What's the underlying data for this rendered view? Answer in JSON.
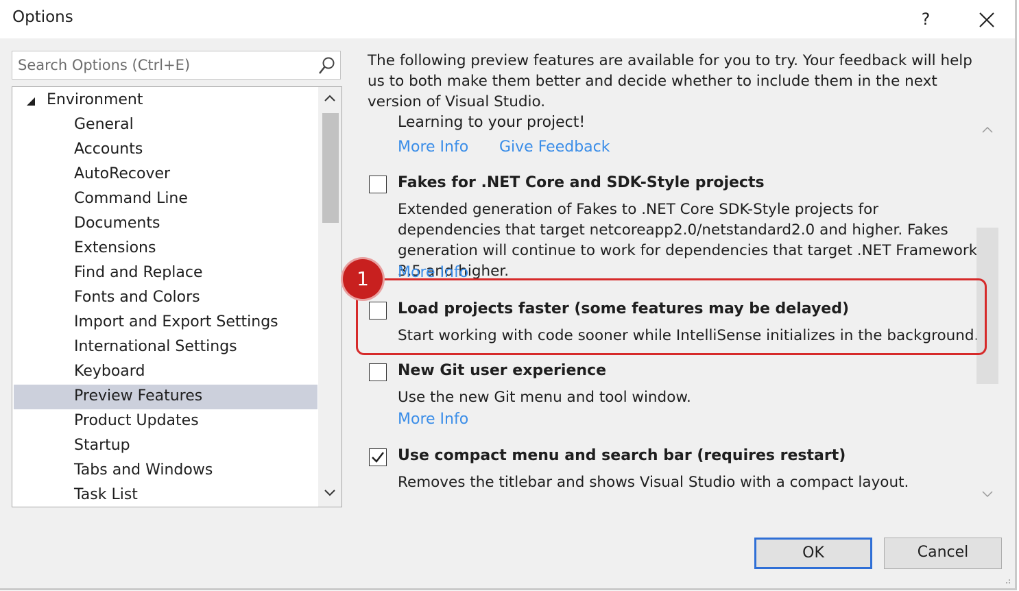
{
  "window": {
    "title": "Options",
    "help_label": "?"
  },
  "search": {
    "placeholder": "Search Options (Ctrl+E)",
    "value": ""
  },
  "tree": {
    "root": "Environment",
    "items": [
      {
        "label": "General"
      },
      {
        "label": "Accounts"
      },
      {
        "label": "AutoRecover"
      },
      {
        "label": "Command Line"
      },
      {
        "label": "Documents"
      },
      {
        "label": "Extensions"
      },
      {
        "label": "Find and Replace"
      },
      {
        "label": "Fonts and Colors"
      },
      {
        "label": "Import and Export Settings"
      },
      {
        "label": "International Settings"
      },
      {
        "label": "Keyboard"
      },
      {
        "label": "Preview Features",
        "selected": true
      },
      {
        "label": "Product Updates"
      },
      {
        "label": "Startup"
      },
      {
        "label": "Tabs and Windows"
      },
      {
        "label": "Task List"
      }
    ]
  },
  "content": {
    "intro": "The following preview features are available for you to try. Your feedback will help us to both make them better and decide whether to include them in the next version of Visual Studio.",
    "partial_feature": {
      "title": "Learning to your project!",
      "more_info": "More Info",
      "give_feedback": "Give Feedback"
    },
    "features": [
      {
        "title": "Fakes for .NET Core and SDK-Style projects",
        "description": "Extended generation of Fakes to .NET Core SDK-Style projects for dependencies that target netcoreapp2.0/netstandard2.0 and higher. Fakes generation will continue to work for dependencies that target .NET Framework 3.5 and higher.",
        "more_info": "More Info",
        "checked": false
      },
      {
        "title": "Load projects faster (some features may be delayed)",
        "description": "Start working with code sooner while IntelliSense initializes in the background.",
        "checked": false
      },
      {
        "title": "New Git user experience",
        "description": "Use the new Git menu and tool window.",
        "more_info": "More Info",
        "checked": false
      },
      {
        "title": "Use compact menu and search bar (requires restart)",
        "description": "Removes the titlebar and shows Visual Studio with a compact layout.",
        "checked": true
      }
    ]
  },
  "callout": {
    "number": "1",
    "color": "#d62a2a"
  },
  "buttons": {
    "ok": "OK",
    "cancel": "Cancel"
  },
  "colors": {
    "link": "#3a8de8",
    "selected_row": "#ccd0dc",
    "ok_border": "#2f6fd6"
  }
}
